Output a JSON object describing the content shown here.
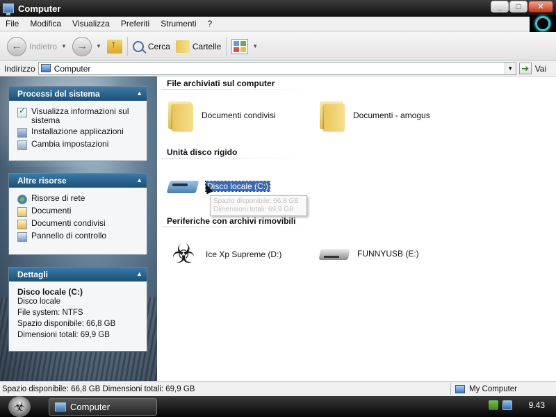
{
  "window": {
    "title": "Computer"
  },
  "menu": [
    "File",
    "Modifica",
    "Visualizza",
    "Preferiti",
    "Strumenti",
    "?"
  ],
  "toolbar": {
    "back": "Indietro",
    "search": "Cerca",
    "folders": "Cartelle"
  },
  "address": {
    "label": "Indirizzo",
    "value": "Computer",
    "go": "Vai"
  },
  "left": {
    "system_tasks": {
      "title": "Processi del sistema",
      "items": [
        "Visualizza informazioni sul sistema",
        "Installazione applicazioni",
        "Cambia impostazioni"
      ]
    },
    "other_places": {
      "title": "Altre risorse",
      "items": [
        "Risorse di rete",
        "Documenti",
        "Documenti condivisi",
        "Pannello di controllo"
      ]
    },
    "details": {
      "title": "Dettagli",
      "name": "Disco locale (C:)",
      "type": "Disco locale",
      "filesystem": "File system: NTFS",
      "free": "Spazio disponibile: 66,8 GB",
      "total": "Dimensioni totali: 69,9 GB"
    }
  },
  "content": {
    "groups": [
      {
        "title": "File archiviati sul computer",
        "items": [
          "Documenti condivisi",
          "Documenti - amogus"
        ]
      },
      {
        "title": "Unità disco rigido",
        "items": [
          "Disco locale (C:)"
        ]
      },
      {
        "title": "Periferiche con archivi rimovibili",
        "items": [
          "Ice Xp Supreme (D:)",
          "FUNNYUSB (E:)"
        ]
      }
    ],
    "tooltip": {
      "line1": "Spazio disponibile: 66,8 GB",
      "line2": "Dimensioni totali: 69,9 GB"
    }
  },
  "status": {
    "text": "Spazio disponibile: 66,8 GB Dimensioni totali: 69,9 GB",
    "zone": "My Computer"
  },
  "taskbar": {
    "button": "Computer",
    "time": "9.43"
  },
  "icons": {
    "window": "computer-icon",
    "back": "back-arrow-icon",
    "forward": "forward-arrow-icon",
    "up": "up-folder-icon",
    "search": "search-icon",
    "folders": "folders-icon",
    "views": "views-icon",
    "drive_c": "hard-drive-icon",
    "drive_d": "biohazard-disc-icon",
    "drive_e": "usb-drive-icon",
    "start": "start-orb-icon"
  },
  "colors": {
    "panel_header": "#1d4f76",
    "selection": "#3d6bb3",
    "taskbar": "#050505"
  }
}
